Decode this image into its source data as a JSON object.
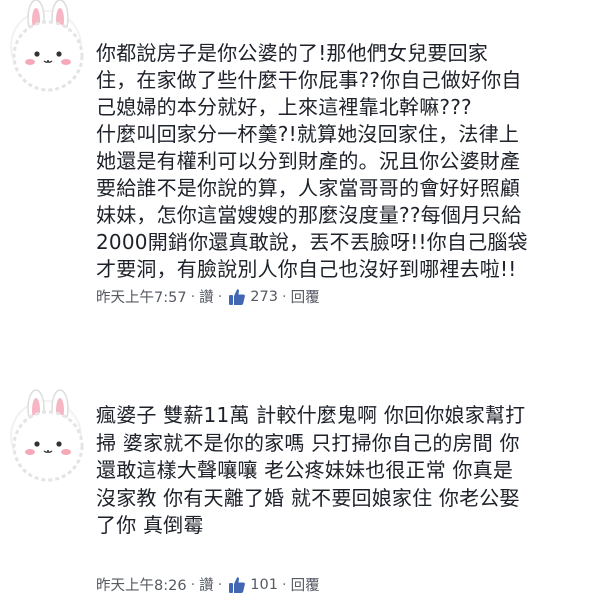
{
  "comments": [
    {
      "avatar_icon": "bunny-avatar-icon",
      "text": "你都說房子是你公婆的了!那他們女兒要回家\n住，在家做了些什麼干你屁事??你自己做好你自\n己媳婦的本分就好，上來這裡靠北幹嘛???\n什麼叫回家分一杯羹?!就算她沒回家住，法律上\n她還是有權利可以分到財產的。況且你公婆財產\n要給誰不是你說的算，人家當哥哥的會好好照顧\n妹妹，怎你這當嫂嫂的那麼沒度量??每個月只給\n2000開銷你還真敢說，丟不丟臉呀!!你自己腦袋\n才要洞，有臉說別人你自己也沒好到哪裡去啦!!",
      "timestamp": "昨天上午7:57",
      "sep1": "·",
      "like_label": "讚",
      "sep2": "·",
      "like_count": "273",
      "sep3": "·",
      "reply_label": "回覆"
    },
    {
      "avatar_icon": "bunny-avatar-icon",
      "text": "瘋婆子 雙薪11萬 計較什麼鬼啊 你回你娘家幫打\n掃 婆家就不是你的家嗎 只打掃你自己的房間 你\n還敢這樣大聲嚷嚷 老公疼妹妹也很正常 你真是\n沒家教 你有天離了婚 就不要回娘家住 你老公娶\n了你 真倒霉",
      "timestamp": "昨天上午8:26",
      "sep1": "·",
      "like_label": "讚",
      "sep2": "·",
      "like_count": "101",
      "sep3": "·",
      "reply_label": "回覆"
    }
  ],
  "colors": {
    "like_blue": "#4267b2",
    "meta_gray": "#555a63",
    "text": "#1d2129",
    "bunny_ear_pink": "#f6b6c4",
    "bunny_cheek": "#f7a8b8"
  }
}
